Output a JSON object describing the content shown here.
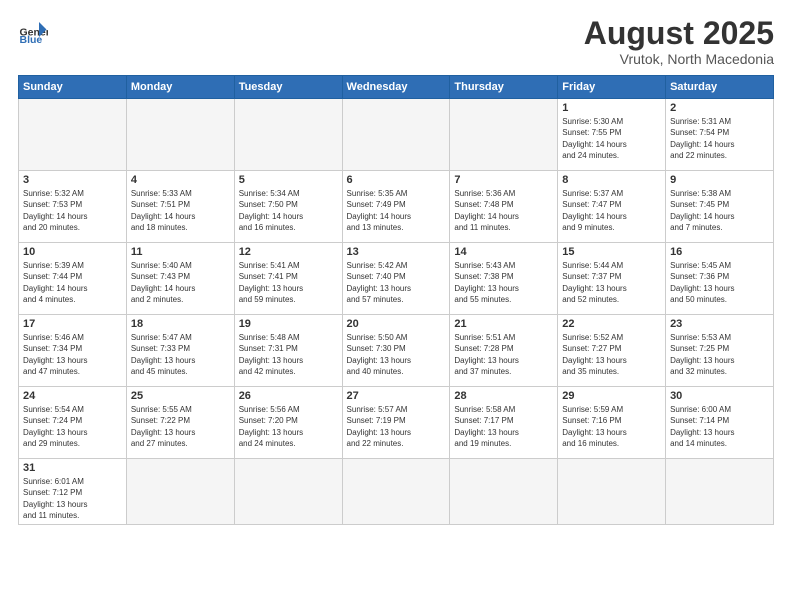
{
  "header": {
    "logo_general": "General",
    "logo_blue": "Blue",
    "title": "August 2025",
    "subtitle": "Vrutok, North Macedonia"
  },
  "weekdays": [
    "Sunday",
    "Monday",
    "Tuesday",
    "Wednesday",
    "Thursday",
    "Friday",
    "Saturday"
  ],
  "days": [
    {
      "number": "",
      "info": "",
      "empty": true
    },
    {
      "number": "",
      "info": "",
      "empty": true
    },
    {
      "number": "",
      "info": "",
      "empty": true
    },
    {
      "number": "",
      "info": "",
      "empty": true
    },
    {
      "number": "",
      "info": "",
      "empty": true
    },
    {
      "number": "1",
      "info": "Sunrise: 5:30 AM\nSunset: 7:55 PM\nDaylight: 14 hours\nand 24 minutes.",
      "empty": false
    },
    {
      "number": "2",
      "info": "Sunrise: 5:31 AM\nSunset: 7:54 PM\nDaylight: 14 hours\nand 22 minutes.",
      "empty": false
    },
    {
      "number": "3",
      "info": "Sunrise: 5:32 AM\nSunset: 7:53 PM\nDaylight: 14 hours\nand 20 minutes.",
      "empty": false
    },
    {
      "number": "4",
      "info": "Sunrise: 5:33 AM\nSunset: 7:51 PM\nDaylight: 14 hours\nand 18 minutes.",
      "empty": false
    },
    {
      "number": "5",
      "info": "Sunrise: 5:34 AM\nSunset: 7:50 PM\nDaylight: 14 hours\nand 16 minutes.",
      "empty": false
    },
    {
      "number": "6",
      "info": "Sunrise: 5:35 AM\nSunset: 7:49 PM\nDaylight: 14 hours\nand 13 minutes.",
      "empty": false
    },
    {
      "number": "7",
      "info": "Sunrise: 5:36 AM\nSunset: 7:48 PM\nDaylight: 14 hours\nand 11 minutes.",
      "empty": false
    },
    {
      "number": "8",
      "info": "Sunrise: 5:37 AM\nSunset: 7:47 PM\nDaylight: 14 hours\nand 9 minutes.",
      "empty": false
    },
    {
      "number": "9",
      "info": "Sunrise: 5:38 AM\nSunset: 7:45 PM\nDaylight: 14 hours\nand 7 minutes.",
      "empty": false
    },
    {
      "number": "10",
      "info": "Sunrise: 5:39 AM\nSunset: 7:44 PM\nDaylight: 14 hours\nand 4 minutes.",
      "empty": false
    },
    {
      "number": "11",
      "info": "Sunrise: 5:40 AM\nSunset: 7:43 PM\nDaylight: 14 hours\nand 2 minutes.",
      "empty": false
    },
    {
      "number": "12",
      "info": "Sunrise: 5:41 AM\nSunset: 7:41 PM\nDaylight: 13 hours\nand 59 minutes.",
      "empty": false
    },
    {
      "number": "13",
      "info": "Sunrise: 5:42 AM\nSunset: 7:40 PM\nDaylight: 13 hours\nand 57 minutes.",
      "empty": false
    },
    {
      "number": "14",
      "info": "Sunrise: 5:43 AM\nSunset: 7:38 PM\nDaylight: 13 hours\nand 55 minutes.",
      "empty": false
    },
    {
      "number": "15",
      "info": "Sunrise: 5:44 AM\nSunset: 7:37 PM\nDaylight: 13 hours\nand 52 minutes.",
      "empty": false
    },
    {
      "number": "16",
      "info": "Sunrise: 5:45 AM\nSunset: 7:36 PM\nDaylight: 13 hours\nand 50 minutes.",
      "empty": false
    },
    {
      "number": "17",
      "info": "Sunrise: 5:46 AM\nSunset: 7:34 PM\nDaylight: 13 hours\nand 47 minutes.",
      "empty": false
    },
    {
      "number": "18",
      "info": "Sunrise: 5:47 AM\nSunset: 7:33 PM\nDaylight: 13 hours\nand 45 minutes.",
      "empty": false
    },
    {
      "number": "19",
      "info": "Sunrise: 5:48 AM\nSunset: 7:31 PM\nDaylight: 13 hours\nand 42 minutes.",
      "empty": false
    },
    {
      "number": "20",
      "info": "Sunrise: 5:50 AM\nSunset: 7:30 PM\nDaylight: 13 hours\nand 40 minutes.",
      "empty": false
    },
    {
      "number": "21",
      "info": "Sunrise: 5:51 AM\nSunset: 7:28 PM\nDaylight: 13 hours\nand 37 minutes.",
      "empty": false
    },
    {
      "number": "22",
      "info": "Sunrise: 5:52 AM\nSunset: 7:27 PM\nDaylight: 13 hours\nand 35 minutes.",
      "empty": false
    },
    {
      "number": "23",
      "info": "Sunrise: 5:53 AM\nSunset: 7:25 PM\nDaylight: 13 hours\nand 32 minutes.",
      "empty": false
    },
    {
      "number": "24",
      "info": "Sunrise: 5:54 AM\nSunset: 7:24 PM\nDaylight: 13 hours\nand 29 minutes.",
      "empty": false
    },
    {
      "number": "25",
      "info": "Sunrise: 5:55 AM\nSunset: 7:22 PM\nDaylight: 13 hours\nand 27 minutes.",
      "empty": false
    },
    {
      "number": "26",
      "info": "Sunrise: 5:56 AM\nSunset: 7:20 PM\nDaylight: 13 hours\nand 24 minutes.",
      "empty": false
    },
    {
      "number": "27",
      "info": "Sunrise: 5:57 AM\nSunset: 7:19 PM\nDaylight: 13 hours\nand 22 minutes.",
      "empty": false
    },
    {
      "number": "28",
      "info": "Sunrise: 5:58 AM\nSunset: 7:17 PM\nDaylight: 13 hours\nand 19 minutes.",
      "empty": false
    },
    {
      "number": "29",
      "info": "Sunrise: 5:59 AM\nSunset: 7:16 PM\nDaylight: 13 hours\nand 16 minutes.",
      "empty": false
    },
    {
      "number": "30",
      "info": "Sunrise: 6:00 AM\nSunset: 7:14 PM\nDaylight: 13 hours\nand 14 minutes.",
      "empty": false
    },
    {
      "number": "31",
      "info": "Sunrise: 6:01 AM\nSunset: 7:12 PM\nDaylight: 13 hours\nand 11 minutes.",
      "empty": false
    },
    {
      "number": "",
      "info": "",
      "empty": true
    },
    {
      "number": "",
      "info": "",
      "empty": true
    },
    {
      "number": "",
      "info": "",
      "empty": true
    },
    {
      "number": "",
      "info": "",
      "empty": true
    },
    {
      "number": "",
      "info": "",
      "empty": true
    },
    {
      "number": "",
      "info": "",
      "empty": true
    }
  ]
}
